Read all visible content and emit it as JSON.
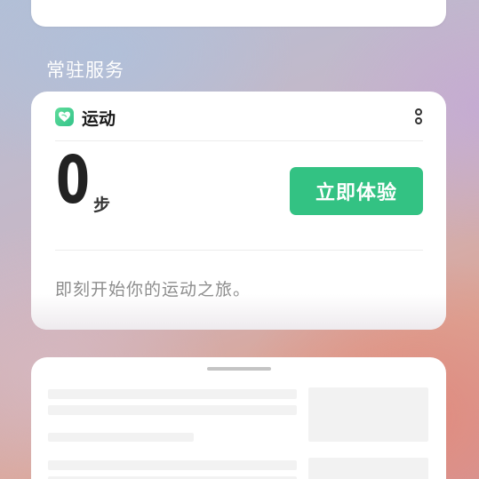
{
  "section": {
    "title": "常驻服务"
  },
  "sport_card": {
    "app_name": "运动",
    "steps_value": "0",
    "steps_unit": "步",
    "action_label": "立即体验",
    "tagline": "即刻开始你的运动之旅。",
    "icon": "heart-leaf-icon",
    "accent_color": "#33c283"
  },
  "icons": {
    "more": "more-vertical-icon"
  }
}
